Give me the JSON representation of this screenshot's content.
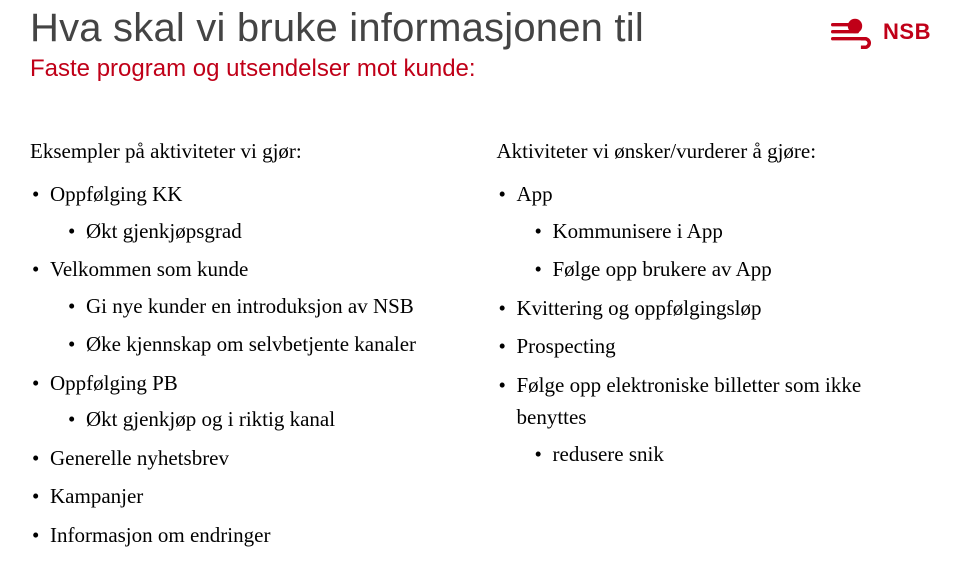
{
  "header": {
    "title": "Hva skal vi bruke informasjonen til",
    "subtitle": "Faste program og utsendelser mot kunde:",
    "logo_text": "NSB"
  },
  "left": {
    "heading": "Eksempler på aktiviteter vi gjør:",
    "items": {
      "i0": {
        "label": "Oppfølging KK",
        "sub": {
          "s0": "Økt gjenkjøpsgrad"
        }
      },
      "i1": {
        "label": "Velkommen som kunde",
        "sub": {
          "s0": "Gi nye kunder en introduksjon av NSB",
          "s1": "Øke kjennskap om selvbetjente kanaler"
        }
      },
      "i2": {
        "label": "Oppfølging PB",
        "sub": {
          "s0": "Økt gjenkjøp og i riktig kanal"
        }
      },
      "i3": {
        "label": "Generelle nyhetsbrev"
      },
      "i4": {
        "label": "Kampanjer"
      },
      "i5": {
        "label": "Informasjon om endringer"
      }
    }
  },
  "right": {
    "heading": "Aktiviteter vi ønsker/vurderer å gjøre:",
    "items": {
      "i0": {
        "label": "App",
        "sub": {
          "s0": "Kommunisere i App",
          "s1": "Følge opp brukere av App"
        }
      },
      "i1": {
        "label": "Kvittering og oppfølgingsløp"
      },
      "i2": {
        "label": "Prospecting"
      },
      "i3": {
        "label": "Følge opp elektroniske billetter som ikke benyttes",
        "sub": {
          "s0": "redusere snik"
        }
      }
    }
  }
}
